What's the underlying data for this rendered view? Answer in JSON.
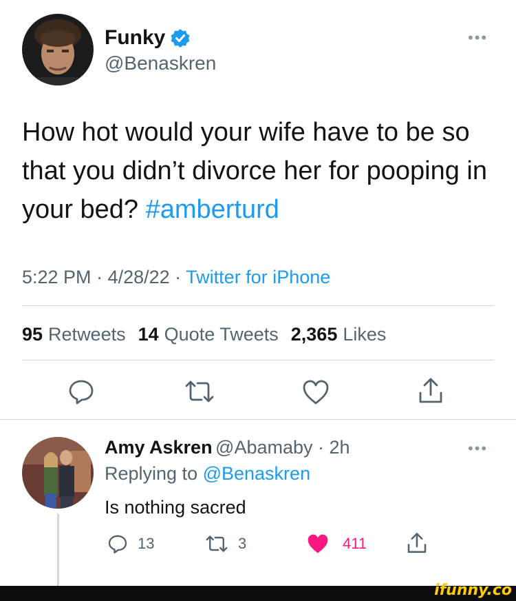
{
  "tweet": {
    "display_name": "Funky",
    "handle": "@Benaskren",
    "more_label": "•••",
    "text_main": "How hot would your wife have to be so that you didn’t divorce her for pooping in your bed? ",
    "hashtag": "#amberturd",
    "time": "5:22 PM",
    "date": "4/28/22",
    "separator": " · ",
    "source": "Twitter for iPhone",
    "stats": {
      "retweets_count": "95",
      "retweets_label": "Retweets",
      "quotes_count": "14",
      "quotes_label": "Quote Tweets",
      "likes_count": "2,365",
      "likes_label": "Likes"
    }
  },
  "reply": {
    "display_name": "Amy Askren",
    "handle": "@Abamaby",
    "age": "2h",
    "replying_prefix": "Replying to ",
    "replying_to": "@Benaskren",
    "text": "Is nothing sacred",
    "reply_count": "13",
    "retweet_count": "3",
    "like_count": "411",
    "more_label": "•••"
  },
  "watermark": "ifunny.co",
  "colors": {
    "accent": "#1d9bf0",
    "like": "#f91880",
    "text": "#0f1419",
    "muted": "#536471",
    "footer": "#0d0d0f",
    "watermark": "#ffcc00"
  }
}
